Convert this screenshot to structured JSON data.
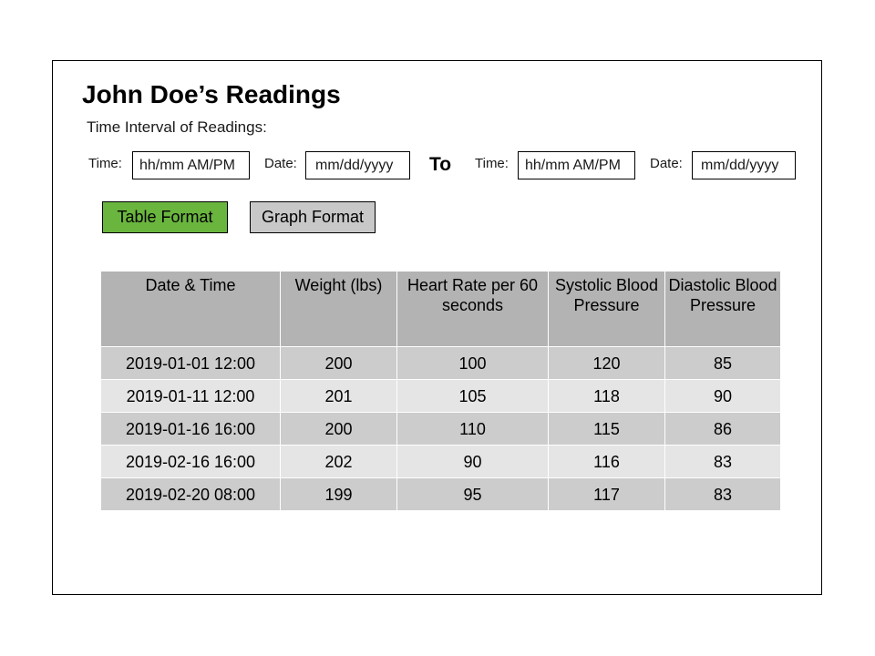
{
  "page": {
    "title": "John Doe’s Readings",
    "subtitle": "Time Interval of Readings:"
  },
  "interval": {
    "start_time_label": "Time:",
    "start_time_placeholder": "hh/mm AM/PM",
    "start_date_label": "Date:",
    "start_date_placeholder": "mm/dd/yyyy",
    "to_label": "To",
    "end_time_label": "Time:",
    "end_time_placeholder": "hh/mm AM/PM",
    "end_date_label": "Date:",
    "end_date_placeholder": "mm/dd/yyyy"
  },
  "format_buttons": {
    "table_label": "Table Format",
    "graph_label": "Graph Format",
    "active": "table",
    "active_color": "#6ab53e",
    "inactive_color": "#c8c8c8"
  },
  "table": {
    "headers": [
      "Date & Time",
      "Weight (lbs)",
      "Heart Rate per 60 seconds",
      "Systolic Blood Pressure",
      "Diastolic Blood Pressure"
    ],
    "rows": [
      [
        "2019-01-01 12:00",
        "200",
        "100",
        "120",
        "85"
      ],
      [
        "2019-01-11 12:00",
        "201",
        "105",
        "118",
        "90"
      ],
      [
        "2019-01-16 16:00",
        "200",
        "110",
        "115",
        "86"
      ],
      [
        "2019-02-16 16:00",
        "202",
        "90",
        "116",
        "83"
      ],
      [
        "2019-02-20 08:00",
        "199",
        "95",
        "117",
        "83"
      ]
    ]
  }
}
